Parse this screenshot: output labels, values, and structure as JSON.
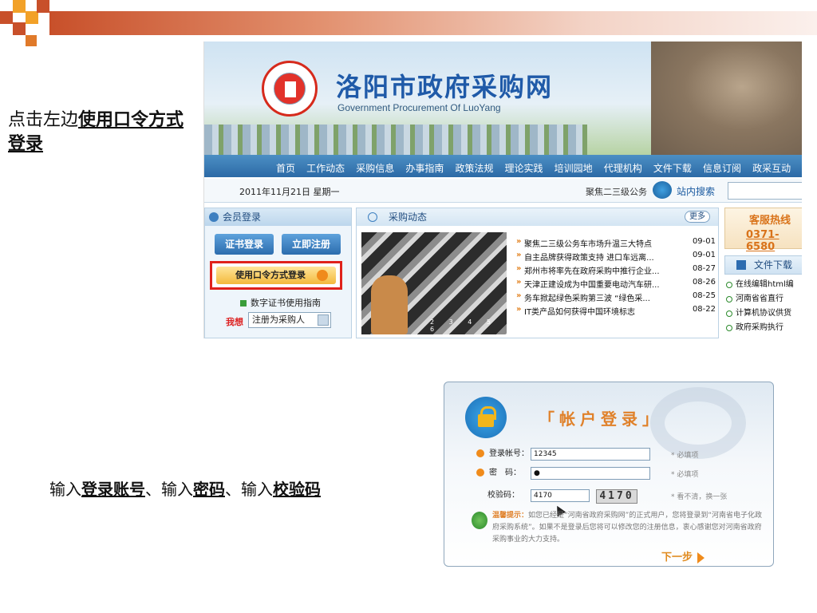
{
  "slide": {
    "note1_prefix": "点击左边",
    "note1_bold": "使用口令方式登录",
    "note2_part1": "输入",
    "note2_b1": "登录账号",
    "note2_part2": "、输入",
    "note2_b2": "密码",
    "note2_part3": "、输入",
    "note2_b3": "校验码"
  },
  "site": {
    "name": "洛阳市政府采购网",
    "subtitle": "Government Procurement Of LuoYang",
    "nav": [
      "首页",
      "工作动态",
      "采购信息",
      "办事指南",
      "政策法规",
      "理论实践",
      "培训园地",
      "代理机构",
      "文件下载",
      "信息订阅",
      "政采互动"
    ],
    "date": "2011年11月21日 星期一",
    "ticker": "聚焦二三级公务",
    "search_label": "站内搜索",
    "member_title": "会员登录",
    "cert_login": "证书登录",
    "register": "立即注册",
    "token_login": "使用口令方式登录",
    "cert_guide": "数字证书使用指南",
    "want_label": "我想",
    "want_value": "注册为采购人",
    "news_title": "采购动态",
    "more": "更多",
    "photo_pages": "2 3 4 5 6",
    "news": [
      {
        "title": "聚焦二三级公务车市场升温三大特点",
        "date": "09-01"
      },
      {
        "title": "自主品牌获得政策支持  进口车远离...",
        "date": "09-01"
      },
      {
        "title": "郑州市将率先在政府采购中推行企业...",
        "date": "08-27"
      },
      {
        "title": "天津正建设成为中国重要电动汽车研...",
        "date": "08-26"
      },
      {
        "title": "务车掀起绿色采购第三波  “绿色采...",
        "date": "08-25"
      },
      {
        "title": "IT类产品如何获得中国环境标志",
        "date": "08-22"
      }
    ],
    "hotline_label": "客服热线",
    "hotline_number": "0371-6580",
    "files_title": "文件下载",
    "files": [
      "在线编辑html编",
      "河南省省直行",
      "计算机协议供货",
      "政府采购执行"
    ]
  },
  "dialog": {
    "title": "「帐户登录」",
    "account_label": "登录帐号：",
    "account_value": "12345",
    "password_label": "密　码：",
    "password_value": "●",
    "captcha_label": "校验码：",
    "captcha_value": "4170",
    "captcha_image": "4170",
    "required": "* 必填项",
    "refresh": "* 看不清，换一张",
    "tip_label": "温馨提示：",
    "tip_text": "如您已经是“河南省政府采购网”的正式用户，您将登录到“河南省电子化政府采购系统”。如果不是登录后您将可以修改您的注册信息，衷心感谢您对河南省政府采购事业的大力支持。",
    "next": "下一步"
  },
  "colors": {
    "accent_red": "#e0221b",
    "brand_blue": "#2c6aa6",
    "orange": "#f08b1b"
  }
}
